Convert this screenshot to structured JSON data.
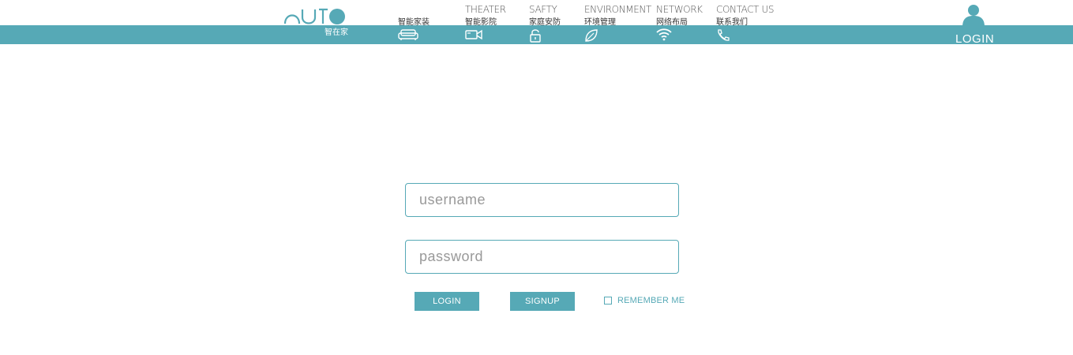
{
  "brand": {
    "logo_icon": "auto-logo-icon",
    "subtitle": "智在家",
    "accent_color": "#56a9b6"
  },
  "nav": {
    "items": [
      {
        "en": "",
        "cn": "智能家装",
        "icon": "sofa-icon"
      },
      {
        "en": "THEATER",
        "cn": "智能影院",
        "icon": "camera-icon"
      },
      {
        "en": "SAFTY",
        "cn": "家庭安防",
        "icon": "lock-icon"
      },
      {
        "en": "ENVIRONMENT",
        "cn": "环境管理",
        "icon": "leaf-icon"
      },
      {
        "en": "NETWORK",
        "cn": "网络布局",
        "icon": "wifi-icon"
      },
      {
        "en": "CONTACT  US",
        "cn": "联系我们",
        "icon": "phone-icon"
      }
    ]
  },
  "header_login": {
    "label": "LOGIN",
    "icon": "user-icon"
  },
  "form": {
    "username_placeholder": "username",
    "username_value": "",
    "password_placeholder": "password",
    "password_value": "",
    "login_label": "LOGIN",
    "signup_label": "SIGNUP",
    "remember_label": "REMEMBER ME",
    "remember_checked": false
  }
}
